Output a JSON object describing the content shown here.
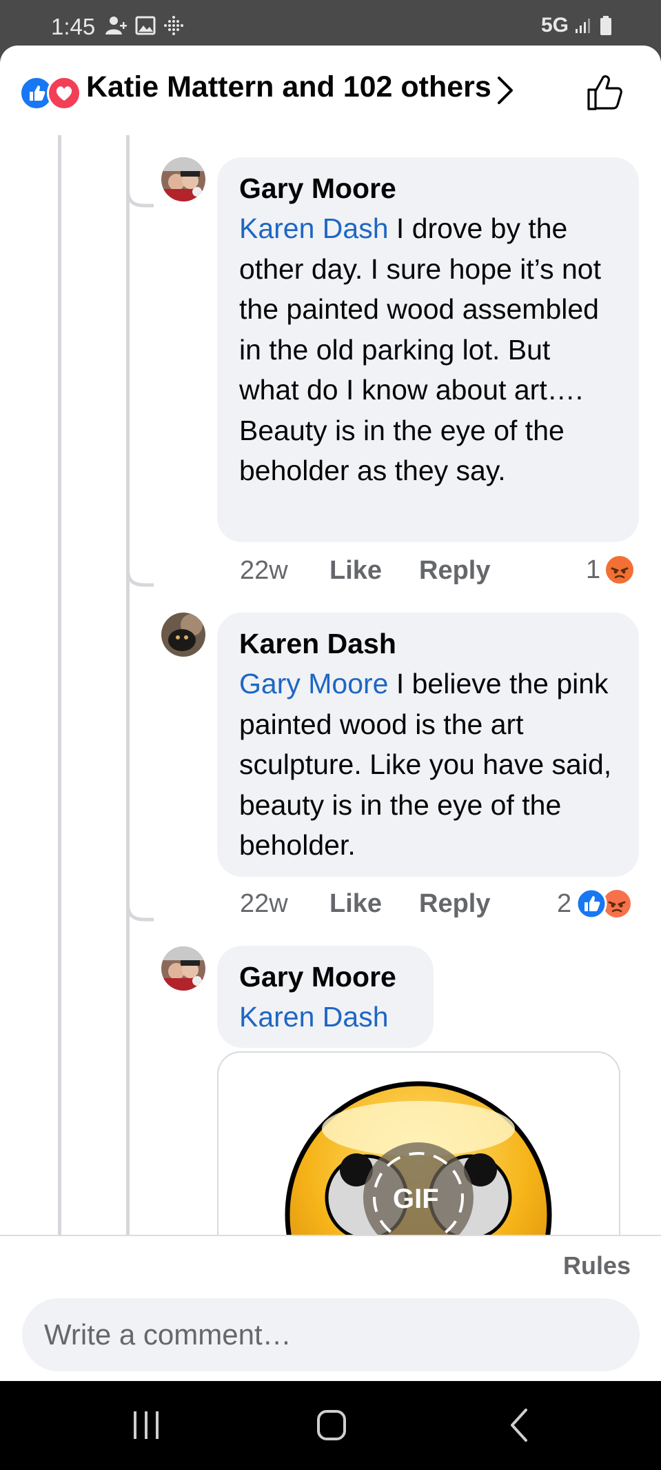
{
  "status_bar": {
    "time": "1:45",
    "network": "5G",
    "icons": [
      "person-add-icon",
      "image-icon",
      "dots-grid-icon",
      "signal-icon",
      "battery-icon"
    ]
  },
  "header": {
    "title": "Katie Mattern and 102 others",
    "reaction_icons": [
      "like-icon",
      "love-icon"
    ],
    "like_button_icon": "thumbs-up-outline-icon"
  },
  "comments": [
    {
      "author": "Gary Moore",
      "mention": "Karen Dash",
      "text": " I drove by the other day. I sure hope it’s not the painted wood assembled in the old parking lot. But what do I know about art…. Beauty is in the eye of the beholder as they say.",
      "age": "22w",
      "like_label": "Like",
      "reply_label": "Reply",
      "reaction_count": "1",
      "reactions": [
        "angry-icon"
      ]
    },
    {
      "author": "Karen Dash",
      "mention": "Gary Moore",
      "text": " I believe the pink painted wood is the art sculpture. Like you have said, beauty is in the eye of the beholder.",
      "age": "22w",
      "like_label": "Like",
      "reply_label": "Reply",
      "reaction_count": "2",
      "reactions": [
        "like-icon",
        "angry-icon"
      ]
    },
    {
      "author": "Gary Moore",
      "mention": "Karen Dash",
      "text": "",
      "attachment": {
        "type": "gif",
        "badge": "GIF"
      }
    }
  ],
  "composer": {
    "rules_label": "Rules",
    "placeholder": "Write a comment…"
  },
  "colors": {
    "mention": "#1e66c4",
    "bubble": "#f0f2f5",
    "like_blue": "#1877f2",
    "love_red": "#f33e58",
    "angry_orange": "#f7714b"
  }
}
